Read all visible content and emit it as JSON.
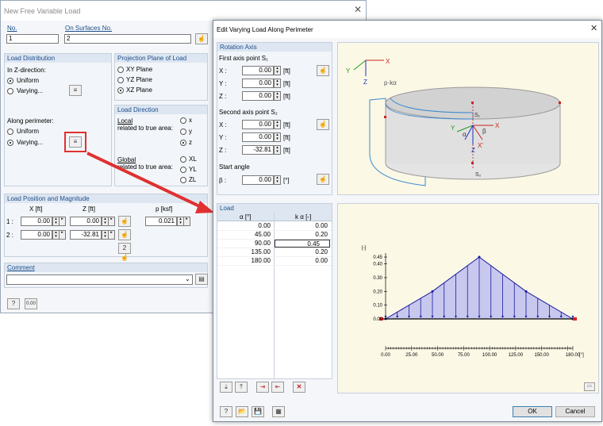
{
  "d1": {
    "title": "New Free Variable Load",
    "no_label": "No.",
    "no_value": "1",
    "surf_label": "On Surfaces No.",
    "surf_value": "2",
    "dist": {
      "title": "Load Distribution",
      "inz": "In Z-direction:",
      "uniform": "Uniform",
      "varying": "Varying...",
      "along": "Along perimeter:",
      "uniform2": "Uniform",
      "varying2": "Varying..."
    },
    "proj": {
      "title": "Projection Plane of Load",
      "xy": "XY Plane",
      "yz": "YZ Plane",
      "xz": "XZ Plane"
    },
    "dir": {
      "title": "Load Direction",
      "local": "Local",
      "local_sub": "related to true area:",
      "x": "x",
      "y": "y",
      "z": "z",
      "global": "Global",
      "global_sub": "related to true area:",
      "xl": "XL",
      "yl": "YL",
      "zl": "ZL"
    },
    "pos": {
      "title": "Load Position and Magnitude",
      "hx": "X [ft]",
      "hz": "Z [ft]",
      "hp": "p [ksf]",
      "r1": "1 :",
      "r2": "2 :",
      "x1": "0.00",
      "z1": "0.00",
      "p1": "0.021",
      "x2": "0.00",
      "z2": "-32.81"
    },
    "comment": {
      "title": "Comment",
      "value": ""
    }
  },
  "d2": {
    "title": "Edit Varying Load Along Perimeter",
    "rot": {
      "title": "Rotation Axis",
      "first": "First axis point S₁",
      "second": "Second axis point S₂",
      "start": "Start angle",
      "xl": "X :",
      "yl": "Y :",
      "zl": "Z :",
      "bl": "β :",
      "x1": "0.00",
      "y1": "0.00",
      "z1": "0.00",
      "x2": "0.00",
      "y2": "0.00",
      "z2": "-32.81",
      "beta": "0.00",
      "ft": "[ft]",
      "deg": "[°]"
    },
    "load": {
      "title": "Load",
      "h1": "α [°]",
      "h2": "k α [-]",
      "rows": [
        {
          "a": "0.00",
          "k": "0.00"
        },
        {
          "a": "45.00",
          "k": "0.20"
        },
        {
          "a": "90.00",
          "k": "0.45"
        },
        {
          "a": "135.00",
          "k": "0.20"
        },
        {
          "a": "180.00",
          "k": "0.00"
        }
      ]
    },
    "ok": "OK",
    "cancel": "Cancel"
  },
  "model": {
    "p_label": "p·kα",
    "s1": "S₁",
    "s2": "S₂",
    "x": "X",
    "y": "Y",
    "z": "Z",
    "alpha": "α",
    "beta": "β",
    "xp": "X'"
  },
  "chart_data": {
    "type": "line",
    "x": [
      0,
      45,
      90,
      135,
      180
    ],
    "values": [
      0,
      0.2,
      0.45,
      0.2,
      0
    ],
    "xticks": [
      "0.00",
      "25.00",
      "50.00",
      "75.00",
      "100.00",
      "125.00",
      "150.00",
      "180.00"
    ],
    "yticks": [
      "0.00",
      "0.10",
      "0.20",
      "0.30",
      "0.40",
      "0.45"
    ],
    "ylabel": "[-]",
    "xunit": "[°]",
    "xlim": [
      0,
      180
    ],
    "ylim": [
      0,
      0.45
    ],
    "fill_color": "#c8c8ef",
    "line_color": "#1a1aa0"
  }
}
